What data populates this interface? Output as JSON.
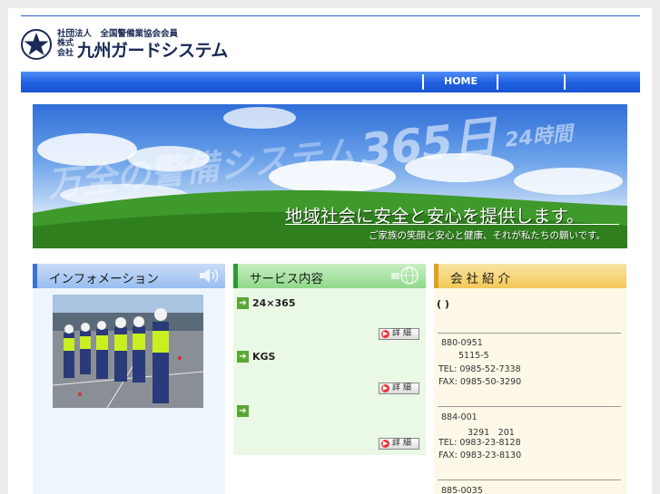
{
  "header": {
    "org_small": "社団法人　全国警備業協会会員",
    "kabushiki_line1": "株式",
    "kabushiki_line2": "会社",
    "company_name": "九州ガードシステム"
  },
  "nav": {
    "items": [
      {
        "label": "HOME"
      },
      {
        "label": ""
      },
      {
        "label": ""
      }
    ]
  },
  "hero": {
    "big_text": "365日",
    "hours_text": "24時間",
    "ghost_text": "万全の警備システム",
    "main_text": "地域社会に安全と安心を提供します。",
    "sub_text": "ご家族の笑顔と安心と健康、それが私たちの願いです。"
  },
  "info": {
    "title": "インフォメーション"
  },
  "services": {
    "title": "サービス内容",
    "items": [
      {
        "label": "24×365",
        "button": "詳細"
      },
      {
        "label": "KGS",
        "button": "詳細"
      },
      {
        "label": "",
        "button": "詳細"
      }
    ]
  },
  "company": {
    "title": "会社紹介",
    "paren": "( )",
    "offices": [
      {
        "zip": "880-0951",
        "address": "5115-5",
        "tel": "TEL: 0985-52-7338",
        "fax": "FAX: 0985-50-3290"
      },
      {
        "zip": "884-001",
        "address": "3291　201",
        "tel": "TEL: 0983-23-8128",
        "fax": "FAX: 0983-23-8130"
      },
      {
        "zip": "885-0035"
      }
    ]
  },
  "colors": {
    "nav_blue": "#1f5fe0",
    "info_accent": "#3a72d8",
    "service_accent": "#2e9a2e",
    "company_accent": "#e0a020"
  }
}
